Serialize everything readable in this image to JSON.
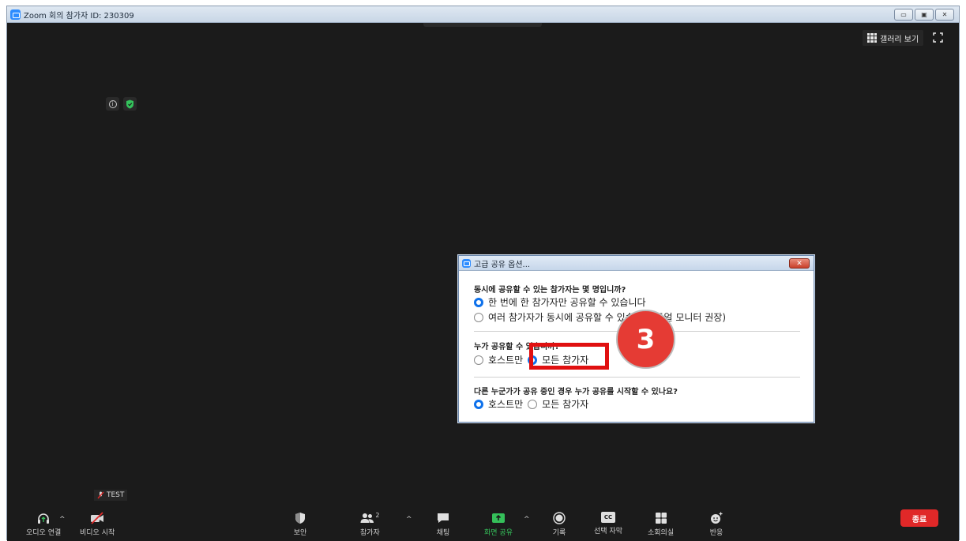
{
  "window": {
    "title": "Zoom 회의 참가자 ID: 230309",
    "controls": [
      "▭",
      "▣",
      "✕"
    ]
  },
  "top": {
    "gallery_label": "갤러리 보기"
  },
  "dialog": {
    "title": "고급 공유 옵션...",
    "close_label": "✕",
    "q1": "동시에 공유할 수 있는 참가자는 몇 명입니까?",
    "q1_opt1": "한 번에 한 참가자만 공유할 수 있습니다",
    "q1_opt2": "여러 참가자가 동시에 공유할 수 있습니다(듀얼 모니터 권장)",
    "q2": "누가 공유할 수 있습니까?",
    "q2_opt1": "호스트만",
    "q2_opt2": "모든 참가자",
    "q3": "다른 누군가가 공유 중인 경우 누가 공유를 시작할 수 있나요?",
    "q3_opt1": "호스트만",
    "q3_opt2": "모든 참가자"
  },
  "annotation": {
    "step": "3"
  },
  "toolbar": {
    "audio": "오디오 연결",
    "video": "비디오 시작",
    "test_label": "TEST",
    "security": "보안",
    "participants": "참가자",
    "participant_count": "2",
    "chat": "채팅",
    "share": "화면 공유",
    "record": "기록",
    "captions": "선택 자막",
    "captions_icon_text": "CC",
    "breakout": "소회의실",
    "reactions": "반응",
    "end": "종료"
  },
  "colors": {
    "accent_blue": "#0e71eb",
    "share_green": "#35c05a",
    "end_red": "#e02828",
    "highlight_red": "#e01010"
  }
}
